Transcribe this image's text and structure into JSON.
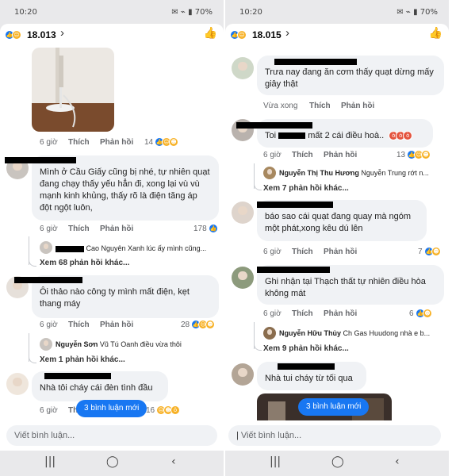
{
  "left": {
    "status": {
      "time": "10:20",
      "icons": "✉ ⌁ ▮ 70%"
    },
    "header": {
      "count": "18.013"
    },
    "comments": [
      {
        "time": "6 giờ",
        "like": "Thích",
        "reply": "Phản hồi",
        "react_count": "14"
      },
      {
        "text": "Mình ở Cầu Giấy cũng bị nhé, tự nhiên quạt đang chạy thấy yếu hẳn đi, xong lại vù vù mạnh kinh khủng, thấy rõ là điện tăng áp đột ngột luôn,",
        "time": "6 giờ",
        "like": "Thích",
        "reply": "Phản hồi",
        "react_count": "178",
        "reply_preview": "Cao Nguyên Xanh lúc ấy mình cũng...",
        "more": "Xem 68 phản hồi khác..."
      },
      {
        "text": "Ôi thảo nào công ty mình mất điện, kẹt thang máy",
        "time": "6 giờ",
        "like": "Thích",
        "reply": "Phản hồi",
        "react_count": "28",
        "reply_name": "Nguyễn Sơn",
        "reply_preview": "Vũ Tú Oanh điều vừa thôi",
        "more": "Xem 1 phản hồi khác..."
      },
      {
        "text": "Nhà tôi cháy cái đèn tình đầu",
        "time": "6 giờ",
        "like": "Thích",
        "react_count": "16"
      }
    ],
    "new_comments": "3 bình luận mới",
    "composer_placeholder": "Viết bình luận..."
  },
  "right": {
    "status": {
      "time": "10:20",
      "icons": "✉ ⌁ ▮ 70%"
    },
    "header": {
      "count": "18.015"
    },
    "comments": [
      {
        "text": "Trưa nay đang ăn cơm thấy quạt dừng mấy giây thật",
        "time": "Vừa xong",
        "like": "Thích",
        "reply": "Phản hồi"
      },
      {
        "text_pre": "Toi ",
        "text_post": "mất 2 cái điều hoà..",
        "time": "6 giờ",
        "like": "Thích",
        "reply": "Phản hồi",
        "react_count": "13",
        "reply_name": "Nguyễn Thị Thu Hương",
        "reply_preview": "Nguyễn Trung rớt n...",
        "more": "Xem 7 phản hồi khác..."
      },
      {
        "text": "báo sao cái quạt đang quay mà ngóm một phát,xong kêu dú lên",
        "time": "6 giờ",
        "like": "Thích",
        "reply": "Phản hồi",
        "react_count": "7"
      },
      {
        "text": "Ghi nhận tại Thạch thất tự nhiên điều hòa không mát",
        "time": "6 giờ",
        "like": "Thích",
        "reply": "Phản hồi",
        "react_count": "6",
        "reply_name": "Nguyễn Hữu Thủy",
        "reply_preview": "Ch Gas Huudong nhà e b...",
        "more": "Xem 9 phản hồi khác..."
      },
      {
        "text": "Nhà tui cháy từ tối qua"
      }
    ],
    "new_comments": "3 bình luận mới",
    "composer_placeholder": "Viết bình luận..."
  },
  "nav": {
    "recents": "|||",
    "home": "◯",
    "back": "‹"
  }
}
